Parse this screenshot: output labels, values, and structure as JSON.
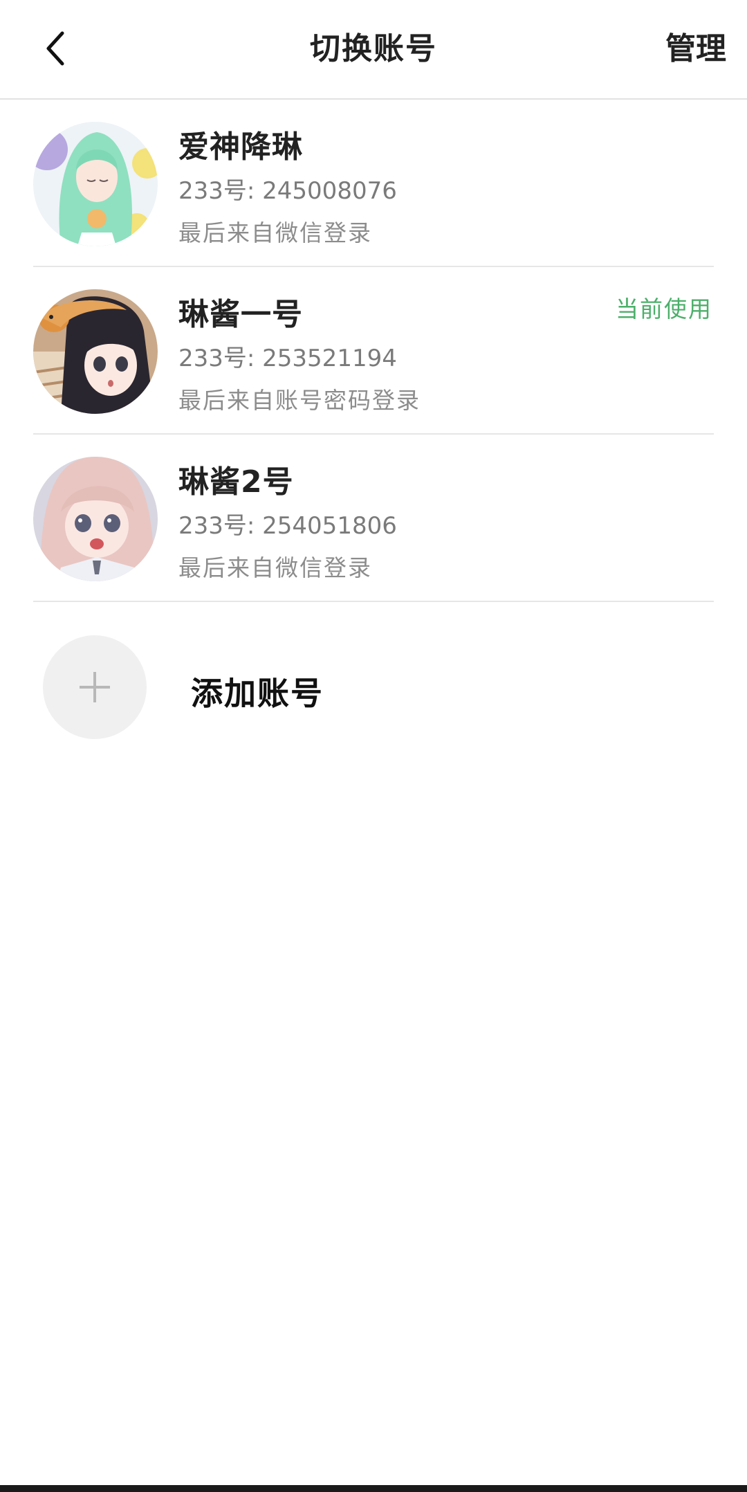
{
  "header": {
    "title": "切换账号",
    "manage_label": "管理"
  },
  "accounts": [
    {
      "name": "爱神降琳",
      "id_text": "233号: 245008076",
      "login_text": "最后来自微信登录",
      "current_label": ""
    },
    {
      "name": "琳酱一号",
      "id_text": "233号: 253521194",
      "login_text": "最后来自账号密码登录",
      "current_label": "当前使用"
    },
    {
      "name": "琳酱2号",
      "id_text": "233号: 254051806",
      "login_text": "最后来自微信登录",
      "current_label": ""
    }
  ],
  "add_account": {
    "label": "添加账号"
  },
  "colors": {
    "current_accent": "#4caf6a",
    "text_primary": "#222222",
    "text_secondary": "#8c8c8c"
  }
}
